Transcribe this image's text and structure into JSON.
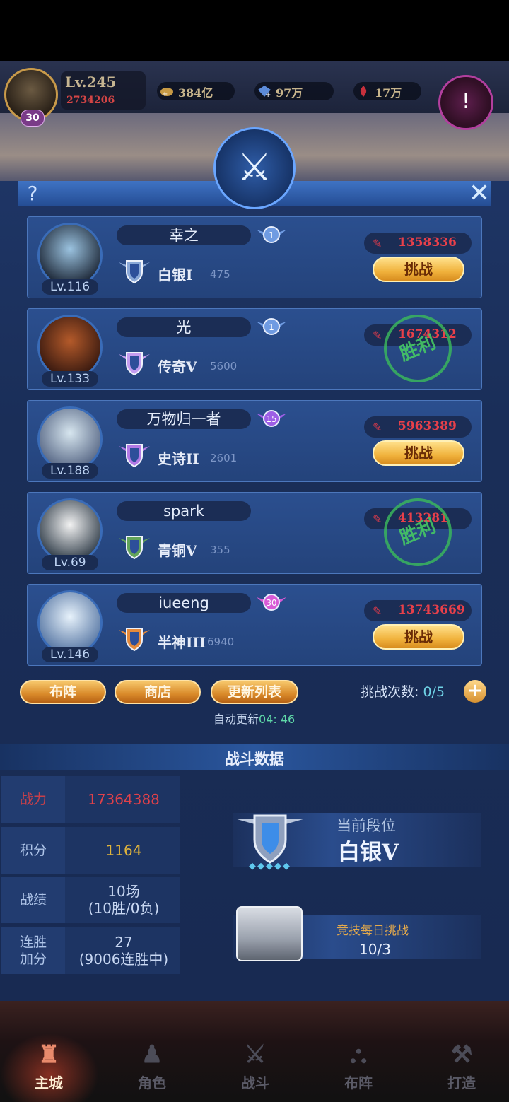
{
  "player": {
    "level": "Lv.245",
    "power": "2734206",
    "vip": "30"
  },
  "resources": [
    {
      "name": "gold-icon",
      "value": "384亿"
    },
    {
      "name": "diamond-icon",
      "value": "97万"
    },
    {
      "name": "blood-gem-icon",
      "value": "17万"
    }
  ],
  "panel": {
    "help": "?",
    "close": "✕"
  },
  "opponents": [
    {
      "name": "幸之",
      "level": "Lv.116",
      "rank": "白银I",
      "score": "475",
      "power": "1358336",
      "action": "挑战",
      "defeated": false,
      "medal": "1"
    },
    {
      "name": "光",
      "level": "Lv.133",
      "rank": "传奇V",
      "score": "5600",
      "power": "1674312",
      "action": "胜利",
      "defeated": true,
      "medal": "1"
    },
    {
      "name": "万物归一者",
      "level": "Lv.188",
      "rank": "史诗II",
      "score": "2601",
      "power": "5963389",
      "action": "挑战",
      "defeated": false,
      "medal": "15"
    },
    {
      "name": "spark",
      "level": "Lv.69",
      "rank": "青铜V",
      "score": "355",
      "power": "413281",
      "action": "胜利",
      "defeated": true,
      "medal": ""
    },
    {
      "name": "iueeng",
      "level": "Lv.146",
      "rank": "半神III",
      "score": "6940",
      "power": "13743669",
      "action": "挑战",
      "defeated": false,
      "medal": "30"
    }
  ],
  "actions": {
    "formation": "布阵",
    "shop": "商店",
    "refresh": "更新列表"
  },
  "challenge": {
    "label": "挑战次数:",
    "count": "0/5",
    "plus": "+"
  },
  "auto_refresh": {
    "label": "自动更新",
    "time": "04: 46"
  },
  "battle_data": {
    "title": "战斗数据",
    "stats": [
      {
        "key": "战力",
        "value": "17364388",
        "sub": ""
      },
      {
        "key": "积分",
        "value": "1164",
        "sub": ""
      },
      {
        "key": "战绩",
        "value": "10场",
        "sub": "(10胜/0负)"
      },
      {
        "key": "连胜\n加分",
        "value": "27",
        "sub": "(9006连胜中)"
      }
    ],
    "current_rank_label": "当前段位",
    "current_rank": "白银V",
    "daily_label": "竞技每日挑战",
    "daily_value": "10/3"
  },
  "nav": [
    {
      "label": "主城",
      "icon": "castle-icon",
      "active": true
    },
    {
      "label": "角色",
      "icon": "hero-icon",
      "active": false
    },
    {
      "label": "战斗",
      "icon": "swords-icon",
      "active": false
    },
    {
      "label": "布阵",
      "icon": "formation-icon",
      "active": false
    },
    {
      "label": "打造",
      "icon": "anvil-icon",
      "active": false
    }
  ],
  "colors": {
    "power": "#e8404a",
    "score": "#e0b43c",
    "accent": "#f0b23c",
    "victory": "#39b55d"
  }
}
